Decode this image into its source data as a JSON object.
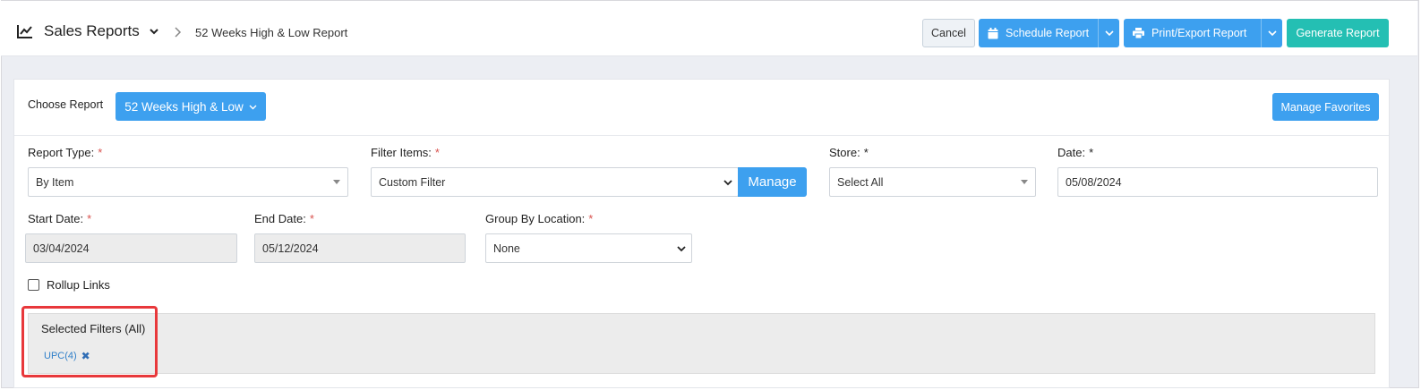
{
  "header": {
    "title": "Sales Reports",
    "breadcrumb": "52 Weeks High & Low Report",
    "cancel_label": "Cancel",
    "schedule_label": "Schedule Report",
    "print_label": "Print/Export Report",
    "generate_label": "Generate Report",
    "icons": [
      "chart-line-icon",
      "chevron-down-icon",
      "chevron-right-icon",
      "calendar-icon",
      "printer-icon"
    ]
  },
  "report": {
    "choose_label": "Choose Report",
    "selected_report": "52 Weeks High & Low",
    "manage_favorites_label": "Manage Favorites"
  },
  "form": {
    "report_type": {
      "label": "Report Type:",
      "required": "*",
      "value": "By Item"
    },
    "filter_items": {
      "label": "Filter Items:",
      "required": "*",
      "value": "Custom Filter",
      "manage_label": "Manage"
    },
    "store": {
      "label": "Store:",
      "required": "*",
      "value": "Select All"
    },
    "date": {
      "label": "Date:",
      "required": "*",
      "value": "05/08/2024"
    },
    "start_date": {
      "label": "Start Date:",
      "required": "*",
      "value": "03/04/2024"
    },
    "end_date": {
      "label": "End Date:",
      "required": "*",
      "value": "05/12/2024"
    },
    "group_by_location": {
      "label": "Group By Location:",
      "required": "*",
      "value": "None"
    },
    "rollup_links": {
      "label": "Rollup Links",
      "checked": false
    }
  },
  "filters": {
    "title": "Selected Filters (All)",
    "chips": [
      {
        "label": "UPC(4)",
        "remove": "✖"
      }
    ]
  },
  "colors": {
    "primary": "#3da0ef",
    "teal": "#24bfb3",
    "required": "#d9534f",
    "highlight": "#e8383b"
  }
}
